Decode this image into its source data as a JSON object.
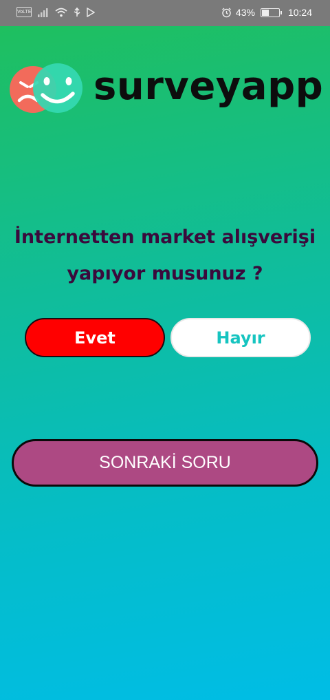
{
  "status_bar": {
    "volte": "VoLTE",
    "battery_percent": "43%",
    "battery_level": 0.43,
    "time": "10:24",
    "icons": [
      "volte-icon",
      "signal-icon",
      "wifi-icon",
      "usb-icon",
      "play-store-icon",
      "alarm-icon",
      "battery-icon"
    ]
  },
  "header": {
    "brand": "surveyapp",
    "logo_colors": {
      "sad": "#f26b5b",
      "happy": "#35d8b2"
    }
  },
  "question": {
    "line1": "İnternetten market alışverişi",
    "line2": "yapıyor musunuz ?"
  },
  "answers": {
    "yes": "Evet",
    "no": "Hayır"
  },
  "next_button": "SONRAKİ SORU",
  "colors": {
    "yes_bg": "#ff0000",
    "no_bg": "#ffffff",
    "no_text": "#16c4c0",
    "next_bg": "#ad4983",
    "question_text": "#3a0a3c",
    "gradient_top": "#1fbf5f",
    "gradient_bottom": "#00bde6"
  }
}
